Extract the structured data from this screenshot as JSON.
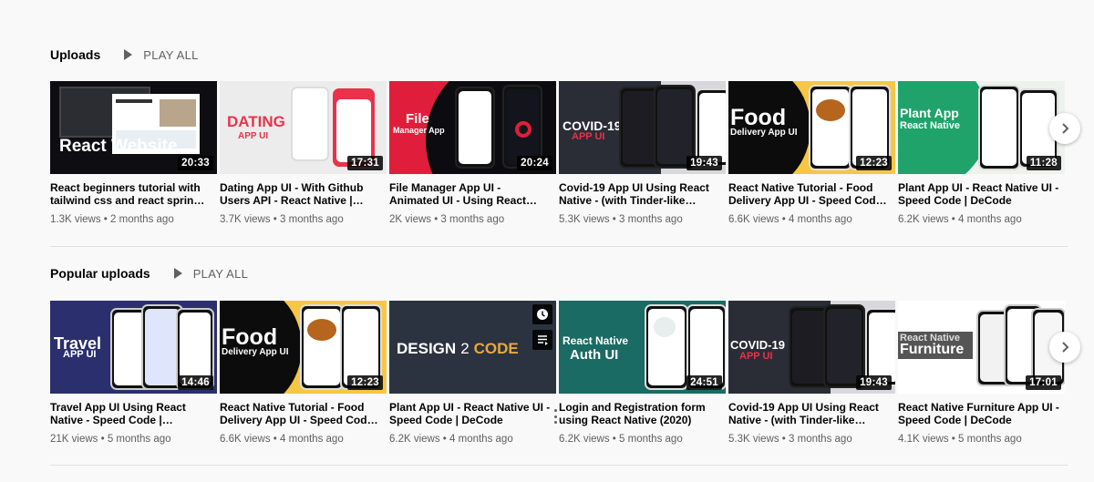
{
  "shelves": [
    {
      "title": "Uploads",
      "play_all": "PLAY ALL",
      "videos": [
        {
          "thumb_text": "React Website",
          "duration": "20:33",
          "title": "React beginners tutorial with tailwind css and react sprin…",
          "meta": "1.3K views • 2 months ago"
        },
        {
          "thumb_text": "DATING",
          "thumb_sub": "APP UI",
          "duration": "17:31",
          "title": "Dating App UI - With Github Users API - React Native |…",
          "meta": "3.7K views • 3 months ago"
        },
        {
          "thumb_text": "File",
          "thumb_sub": "Manager App",
          "duration": "20:24",
          "title": "File Manager App UI - Animated UI - Using React…",
          "meta": "2K views • 3 months ago"
        },
        {
          "thumb_text": "COVID-19",
          "thumb_sub": "APP UI",
          "duration": "19:43",
          "title": "Covid-19 App UI Using React Native - (with Tinder-like…",
          "meta": "5.3K views • 3 months ago"
        },
        {
          "thumb_text": "Food",
          "thumb_sub": "Delivery App UI",
          "duration": "12:23",
          "title": "React Native Tutorial - Food Delivery App UI - Speed Cod…",
          "meta": "6.6K views • 4 months ago"
        },
        {
          "thumb_text": "Plant App",
          "thumb_sub": "React Native",
          "duration": "11:28",
          "title": "Plant App UI - React Native UI - Speed Code | DeCode",
          "meta": "6.2K views • 4 months ago"
        }
      ]
    },
    {
      "title": "Popular uploads",
      "play_all": "PLAY ALL",
      "videos": [
        {
          "thumb_text": "Travel",
          "thumb_sub": "APP UI",
          "duration": "14:46",
          "title": "Travel App UI Using React Native - Speed Code |…",
          "meta": "21K views • 5 months ago"
        },
        {
          "thumb_text": "Food",
          "thumb_sub": "Delivery App UI",
          "duration": "12:23",
          "title": "React Native Tutorial - Food Delivery App UI - Speed Cod…",
          "meta": "6.6K views • 4 months ago"
        },
        {
          "thumb_text": "DESIGN",
          "thumb_sub": "2",
          "thumb_sub2": "CODE",
          "duration": "",
          "title": "Plant App UI - React Native UI - Speed Code | DeCode",
          "meta": "6.2K views • 4 months ago"
        },
        {
          "thumb_text": "React Native",
          "thumb_sub": "Auth UI",
          "duration": "24:51",
          "title": "Login and Registration form using React Native (2020)",
          "meta": "6.2K views • 5 months ago"
        },
        {
          "thumb_text": "COVID-19",
          "thumb_sub": "APP UI",
          "duration": "19:43",
          "title": "Covid-19 App UI Using React Native - (with Tinder-like…",
          "meta": "5.3K views • 3 months ago"
        },
        {
          "thumb_text": "React Native",
          "thumb_sub": "Furniture",
          "duration": "17:01",
          "title": "React Native Furniture App UI - Speed Code | DeCode",
          "meta": "4.1K views • 5 months ago"
        }
      ]
    }
  ],
  "colors": {
    "accent_red": "#e8334a",
    "dark_bg": "#24252b",
    "food_yellow": "#f6c744",
    "plant_green": "#1fa36b",
    "travel_navy": "#2b2f6e",
    "auth_teal": "#1a6b63"
  }
}
